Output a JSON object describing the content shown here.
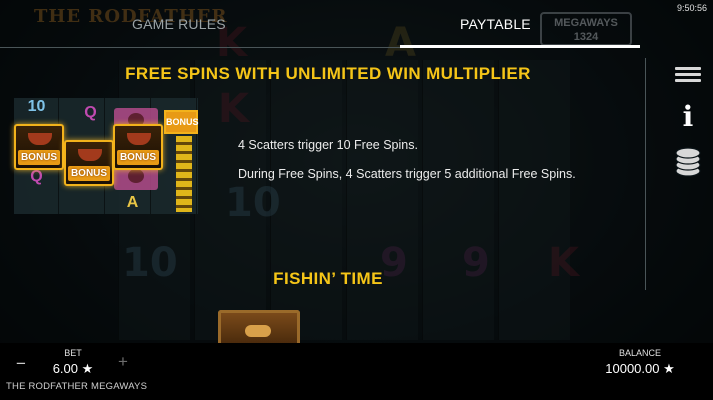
{
  "header": {
    "logo_text": "THE RODFATHER",
    "megaways_logo": "MEGAWAYS",
    "megaways_count": "1324",
    "tabs": [
      {
        "label": "GAME RULES",
        "active": false
      },
      {
        "label": "PAYTABLE",
        "active": true
      }
    ],
    "clock": "9:50:56"
  },
  "sidebar": {
    "icons": [
      "menu-icon",
      "info-icon",
      "coins-icon"
    ]
  },
  "section": {
    "title": "FREE SPINS WITH UNLIMITED WIN MULTIPLIER",
    "lines": [
      "4 Scatters trigger 10 Free Spins.",
      "During Free Spins, 4 Scatters trigger 5 additional Free Spins."
    ],
    "next_title": "FISHIN’ TIME"
  },
  "illustration": {
    "scatter_label": "BONUS",
    "symbols": [
      "10",
      "Q",
      "Q",
      "A"
    ]
  },
  "footer": {
    "bet_label": "BET",
    "bet_value": "6.00 ★",
    "minus": "−",
    "plus": "+",
    "game_name": "THE RODFATHER MEGAWAYS",
    "balance_label": "BALANCE",
    "balance_value": "10000.00 ★"
  },
  "colors": {
    "accent_title": "#f5c518",
    "bonus_orange": "#e89a15",
    "background": "#0b1418"
  }
}
